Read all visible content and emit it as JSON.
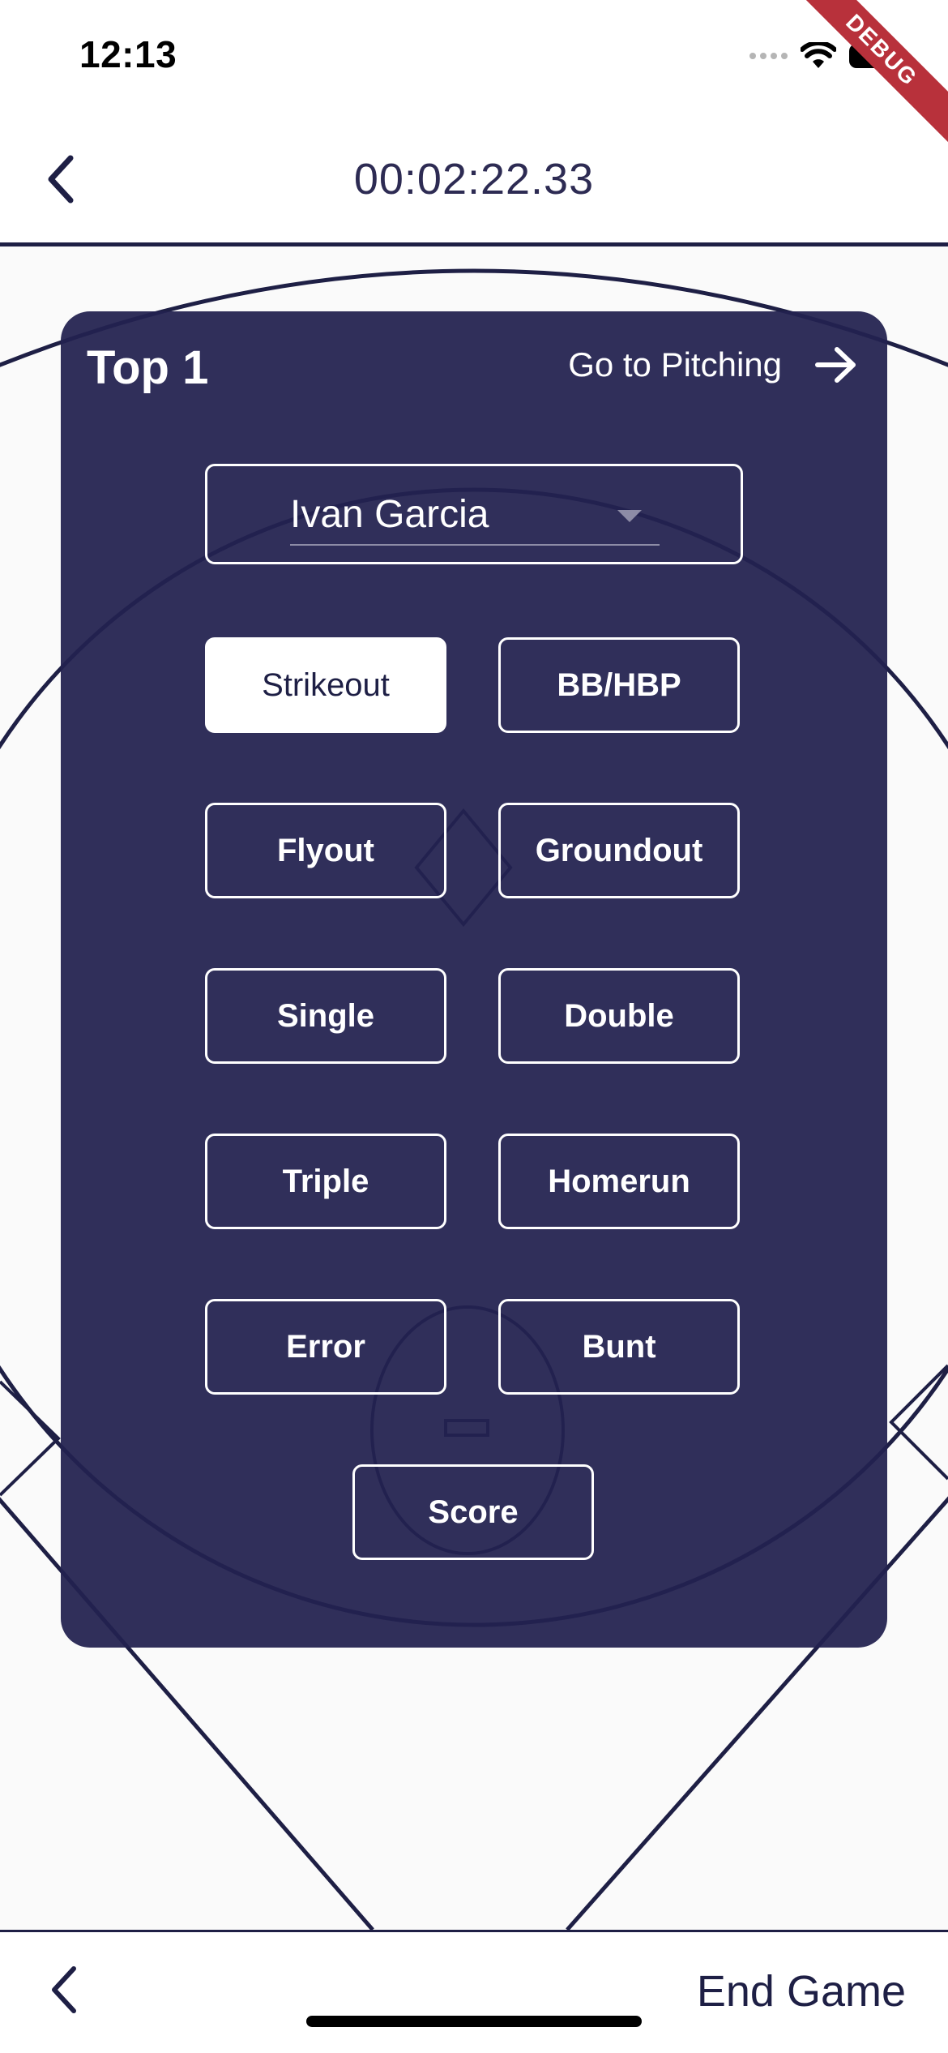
{
  "status_bar": {
    "time": "12:13",
    "debug_label": "DEBUG",
    "icons": [
      "cellular-dots-icon",
      "wifi-icon",
      "battery-icon"
    ]
  },
  "header": {
    "back_icon": "chevron-left-icon",
    "timer": "00:02:22.33"
  },
  "panel": {
    "inning": "Top 1",
    "go_pitching_label": "Go to Pitching",
    "go_pitching_icon": "arrow-right-icon",
    "batter": {
      "selected": "Ivan Garcia",
      "caret_icon": "dropdown-caret-icon"
    },
    "outcomes": [
      {
        "label": "Strikeout",
        "selected": true
      },
      {
        "label": "BB/HBP",
        "selected": false
      },
      {
        "label": "Flyout",
        "selected": false
      },
      {
        "label": "Groundout",
        "selected": false
      },
      {
        "label": "Single",
        "selected": false
      },
      {
        "label": "Double",
        "selected": false
      },
      {
        "label": "Triple",
        "selected": false
      },
      {
        "label": "Homerun",
        "selected": false
      },
      {
        "label": "Error",
        "selected": false
      },
      {
        "label": "Bunt",
        "selected": false
      },
      {
        "label": "Score",
        "selected": false
      }
    ]
  },
  "footer": {
    "back_icon": "chevron-left-icon",
    "end_game_label": "End Game"
  },
  "colors": {
    "navy": "#1e1f45",
    "panel": "#232250",
    "white": "#ffffff",
    "debug_ribbon": "#b8313b"
  }
}
